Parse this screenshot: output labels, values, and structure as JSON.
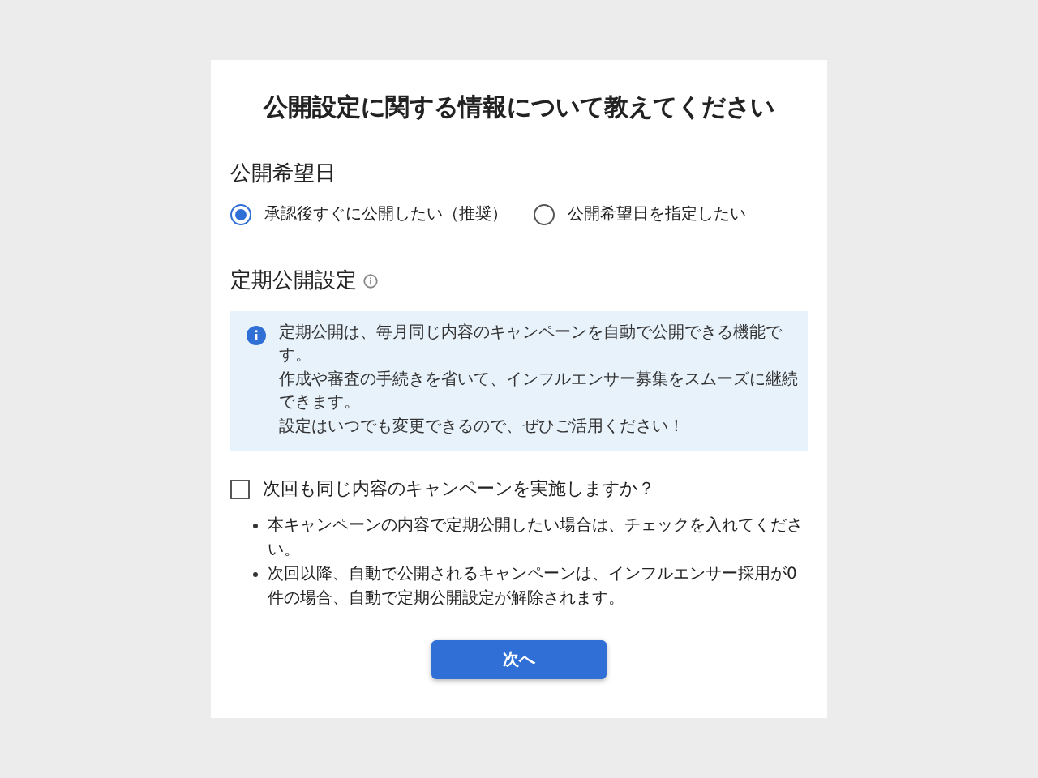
{
  "title": "公開設定に関する情報について教えてください",
  "publish_date": {
    "heading": "公開希望日",
    "options": [
      {
        "label": "承認後すぐに公開したい（推奨）",
        "selected": true
      },
      {
        "label": "公開希望日を指定したい",
        "selected": false
      }
    ]
  },
  "periodic": {
    "heading": "定期公開設定",
    "info_lines": [
      "定期公開は、毎月同じ内容のキャンペーンを自動で公開できる機能です。",
      "作成や審査の手続きを省いて、インフルエンサー募集をスムーズに継続できます。",
      "設定はいつでも変更できるので、ぜひご活用ください！"
    ],
    "checkbox": {
      "label": "次回も同じ内容のキャンペーンを実施しますか？",
      "checked": false
    },
    "notes": [
      "本キャンペーンの内容で定期公開したい場合は、チェックを入れてください。",
      "次回以降、自動で公開されるキャンペーンは、インフルエンサー採用が0件の場合、自動で定期公開設定が解除されます。"
    ]
  },
  "next_button": "次へ"
}
